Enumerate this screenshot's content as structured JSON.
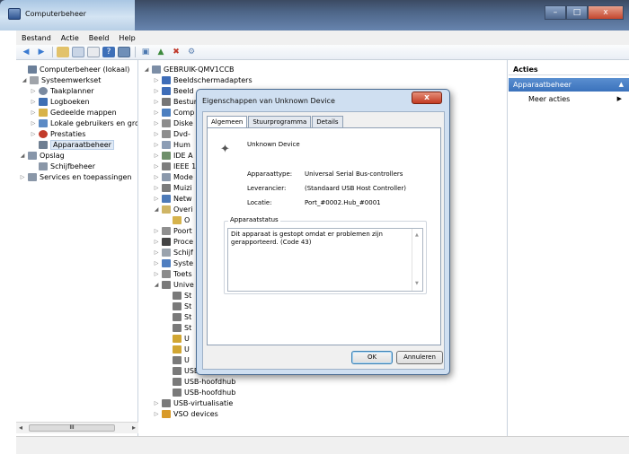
{
  "window": {
    "title": "Computerbeheer",
    "controls": [
      "–",
      "□",
      "x"
    ]
  },
  "menu": [
    "Bestand",
    "Actie",
    "Beeld",
    "Help"
  ],
  "toolbar": {
    "icons": [
      "back-icon",
      "forward-icon",
      "up-icon",
      "show-hide-icon",
      "export-icon",
      "help-icon",
      "properties-icon",
      "scan-hardware-icon",
      "update-driver-icon",
      "disable-icon",
      "uninstall-icon"
    ]
  },
  "left_tree": [
    {
      "label": "Computerbeheer (lokaal)",
      "level": 0,
      "expander": "",
      "color": "#6b7f99"
    },
    {
      "label": "Systeemwerkset",
      "level": 1,
      "expander": "◢",
      "color": "#a0a4aa"
    },
    {
      "label": "Taakplanner",
      "level": 2,
      "expander": "▷",
      "color": "#7a8aa0"
    },
    {
      "label": "Logboeken",
      "level": 2,
      "expander": "▷",
      "color": "#3f6fb3"
    },
    {
      "label": "Gedeelde mappen",
      "level": 2,
      "expander": "▷",
      "color": "#d8b34a"
    },
    {
      "label": "Lokale gebruikers en gro",
      "level": 2,
      "expander": "▷",
      "color": "#5c8bc5"
    },
    {
      "label": "Prestaties",
      "level": 2,
      "expander": "▷",
      "color": "#c23b2a"
    },
    {
      "label": "Apparaatbeheer",
      "level": 2,
      "expander": "",
      "color": "#6f7f92",
      "selected": true
    },
    {
      "label": "Opslag",
      "level": 0.5,
      "expander": "◢",
      "color": "#8796aa"
    },
    {
      "label": "Schijfbeheer",
      "level": 2,
      "expander": "",
      "color": "#8a97a8"
    },
    {
      "label": "Services en toepassingen",
      "level": 0.5,
      "expander": "▷",
      "color": "#8a97a8"
    }
  ],
  "device_tree": [
    {
      "label": "GEBRUIK-QMV1CCB",
      "expander": "◢",
      "level": 0,
      "color": "#7c8ea6"
    },
    {
      "label": "Beeldschermadapters",
      "expander": "▷",
      "level": 1,
      "color": "#3e6db8"
    },
    {
      "label": "Beeld",
      "expander": "▷",
      "level": 1,
      "color": "#3e6db8"
    },
    {
      "label": "Besturi",
      "expander": "▷",
      "level": 1,
      "color": "#767676"
    },
    {
      "label": "Comp",
      "expander": "▷",
      "level": 1,
      "color": "#4c7fc0"
    },
    {
      "label": "Diske",
      "expander": "▷",
      "level": 1,
      "color": "#8d8d8d"
    },
    {
      "label": "Dvd-",
      "expander": "▷",
      "level": 1,
      "color": "#8d8d8d"
    },
    {
      "label": "Hum",
      "expander": "▷",
      "level": 1,
      "color": "#8c9db5"
    },
    {
      "label": "IDE A",
      "expander": "▷",
      "level": 1,
      "color": "#6e8f6a"
    },
    {
      "label": "IEEE 1",
      "expander": "▷",
      "level": 1,
      "color": "#7e7e7e"
    },
    {
      "label": "Mode",
      "expander": "▷",
      "level": 1,
      "color": "#8a98ab"
    },
    {
      "label": "Muizi",
      "expander": "▷",
      "level": 1,
      "color": "#7b7b7b"
    },
    {
      "label": "Netw",
      "expander": "▷",
      "level": 1,
      "color": "#4d7ab8"
    },
    {
      "label": "Overi",
      "expander": "◢",
      "level": 1,
      "color": "#cfb565"
    },
    {
      "label": "O",
      "expander": "",
      "level": 2,
      "color": "#d6b34c"
    },
    {
      "label": "Poort",
      "expander": "▷",
      "level": 1,
      "color": "#8f8f8f"
    },
    {
      "label": "Proce",
      "expander": "▷",
      "level": 1,
      "color": "#444444"
    },
    {
      "label": "Schijf",
      "expander": "▷",
      "level": 1,
      "color": "#9aa3ad"
    },
    {
      "label": "Syste",
      "expander": "▷",
      "level": 1,
      "color": "#4f7ec0"
    },
    {
      "label": "Toets",
      "expander": "▷",
      "level": 1,
      "color": "#8b8b8b"
    },
    {
      "label": "Unive",
      "expander": "◢",
      "level": 1,
      "color": "#7a7a7a"
    },
    {
      "label": "St",
      "expander": "",
      "level": 2,
      "color": "#7a7a7a"
    },
    {
      "label": "St",
      "expander": "",
      "level": 2,
      "color": "#7a7a7a"
    },
    {
      "label": "St",
      "expander": "",
      "level": 2,
      "color": "#7a7a7a"
    },
    {
      "label": "St",
      "expander": "",
      "level": 2,
      "color": "#7a7a7a"
    },
    {
      "label": "U",
      "expander": "",
      "level": 2,
      "color": "#d1a632"
    },
    {
      "label": "U",
      "expander": "",
      "level": 2,
      "color": "#d1a632"
    },
    {
      "label": "U",
      "expander": "",
      "level": 2,
      "color": "#7a7a7a"
    },
    {
      "label": "USB-hoofdhub",
      "expander": "",
      "level": 2,
      "color": "#7a7a7a"
    },
    {
      "label": "USB-hoofdhub",
      "expander": "",
      "level": 2,
      "color": "#7a7a7a"
    },
    {
      "label": "USB-hoofdhub",
      "expander": "",
      "level": 2,
      "color": "#7a7a7a"
    },
    {
      "label": "USB-virtualisatie",
      "expander": "▷",
      "level": 1,
      "color": "#7a7a7a"
    },
    {
      "label": "VSO devices",
      "expander": "▷",
      "level": 1,
      "color": "#d89a2a"
    }
  ],
  "actions": {
    "header": "Acties",
    "section": "Apparaatbeheer",
    "section_arrow": "▲",
    "item": "Meer acties",
    "item_arrow": "▶"
  },
  "dialog": {
    "title": "Eigenschappen van Unknown Device",
    "close_label": "x",
    "tabs": [
      "Algemeen",
      "Stuurprogramma",
      "Details"
    ],
    "device_name": "Unknown Device",
    "properties": [
      {
        "label": "Apparaattype:",
        "value": "Universal Serial Bus-controllers"
      },
      {
        "label": "Leverancier:",
        "value": "(Standaard USB Host Controller)"
      },
      {
        "label": "Locatie:",
        "value": "Port_#0002.Hub_#0001"
      }
    ],
    "status_legend": "Apparaatstatus",
    "status_text": "Dit apparaat is gestopt omdat er problemen zijn gerapporteerd. (Code 43)",
    "ok_label": "OK",
    "cancel_label": "Annuleren"
  },
  "hscroll": {
    "left": "◂",
    "right": "▸",
    "thumb": "III"
  }
}
